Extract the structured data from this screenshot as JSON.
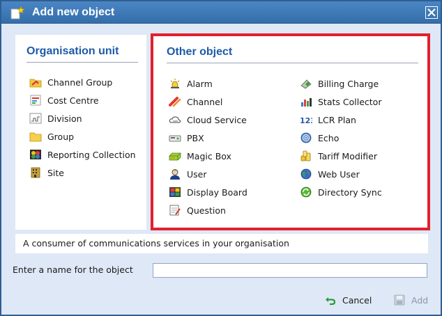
{
  "dialog": {
    "title": "Add new object",
    "close_label": "Close"
  },
  "organisation_unit": {
    "heading": "Organisation unit",
    "items": [
      {
        "label": "Channel Group",
        "icon": "channel-group-icon"
      },
      {
        "label": "Cost Centre",
        "icon": "cost-centre-icon"
      },
      {
        "label": "Division",
        "icon": "division-icon"
      },
      {
        "label": "Group",
        "icon": "folder-icon"
      },
      {
        "label": "Reporting Collection",
        "icon": "reporting-collection-icon"
      },
      {
        "label": "Site",
        "icon": "building-icon"
      }
    ]
  },
  "other_object": {
    "heading": "Other object",
    "left_items": [
      {
        "label": "Alarm",
        "icon": "alarm-icon"
      },
      {
        "label": "Channel",
        "icon": "channel-icon"
      },
      {
        "label": "Cloud Service",
        "icon": "cloud-icon"
      },
      {
        "label": "PBX",
        "icon": "pbx-icon"
      },
      {
        "label": "Magic Box",
        "icon": "magic-box-icon"
      },
      {
        "label": "User",
        "icon": "user-icon"
      },
      {
        "label": "Display Board",
        "icon": "display-board-icon"
      },
      {
        "label": "Question",
        "icon": "question-icon"
      }
    ],
    "right_items": [
      {
        "label": "Billing Charge",
        "icon": "billing-charge-icon"
      },
      {
        "label": "Stats Collector",
        "icon": "stats-collector-icon"
      },
      {
        "label": "LCR Plan",
        "icon": "lcr-plan-icon"
      },
      {
        "label": "Echo",
        "icon": "echo-icon"
      },
      {
        "label": "Tariff Modifier",
        "icon": "tariff-modifier-icon"
      },
      {
        "label": "Web User",
        "icon": "web-user-icon"
      },
      {
        "label": "Directory Sync",
        "icon": "directory-sync-icon"
      }
    ]
  },
  "description": "A consumer of communications services in your organisation",
  "name_field": {
    "label": "Enter a name for the object",
    "value": "",
    "placeholder": ""
  },
  "footer": {
    "cancel_label": "Cancel",
    "add_label": "Add"
  },
  "colors": {
    "titlebar": "#3a76b6",
    "heading": "#1d5aa8",
    "highlight_border": "#e3202c",
    "dialog_bg": "#dfe8f6"
  }
}
